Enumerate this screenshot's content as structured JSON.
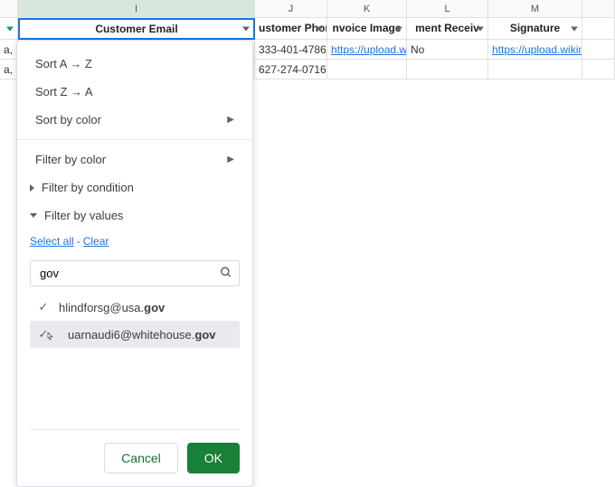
{
  "columns": {
    "I": {
      "label": "Customer Email"
    },
    "J": {
      "label": "ustomer Phor"
    },
    "K": {
      "label": "nvoice Image"
    },
    "L": {
      "label": "ment Receiv"
    },
    "M": {
      "label": "Signature"
    }
  },
  "col_letters": {
    "I": "I",
    "J": "J",
    "K": "K",
    "L": "L",
    "M": "M"
  },
  "rows": [
    {
      "left": "a,",
      "J": "333-401-4786",
      "K": "https://upload.wi",
      "L": "No",
      "M": "https://upload.wikimedia"
    },
    {
      "left": "a,",
      "J": "627-274-0716",
      "K": "",
      "L": "",
      "M": ""
    }
  ],
  "menu": {
    "sort_az": "Sort A → Z",
    "sort_za": "Sort Z → A",
    "sort_color": "Sort by color",
    "filter_color": "Filter by color",
    "filter_condition": "Filter by condition",
    "filter_values": "Filter by values",
    "select_all": "Select all",
    "clear": "Clear",
    "search_value": "gov",
    "values": [
      {
        "prefix": "hlindforsg@usa.",
        "match": "gov",
        "selected": false
      },
      {
        "prefix": "uarnaudi6@whitehouse.",
        "match": "gov",
        "selected": true
      }
    ],
    "cancel": "Cancel",
    "ok": "OK"
  }
}
